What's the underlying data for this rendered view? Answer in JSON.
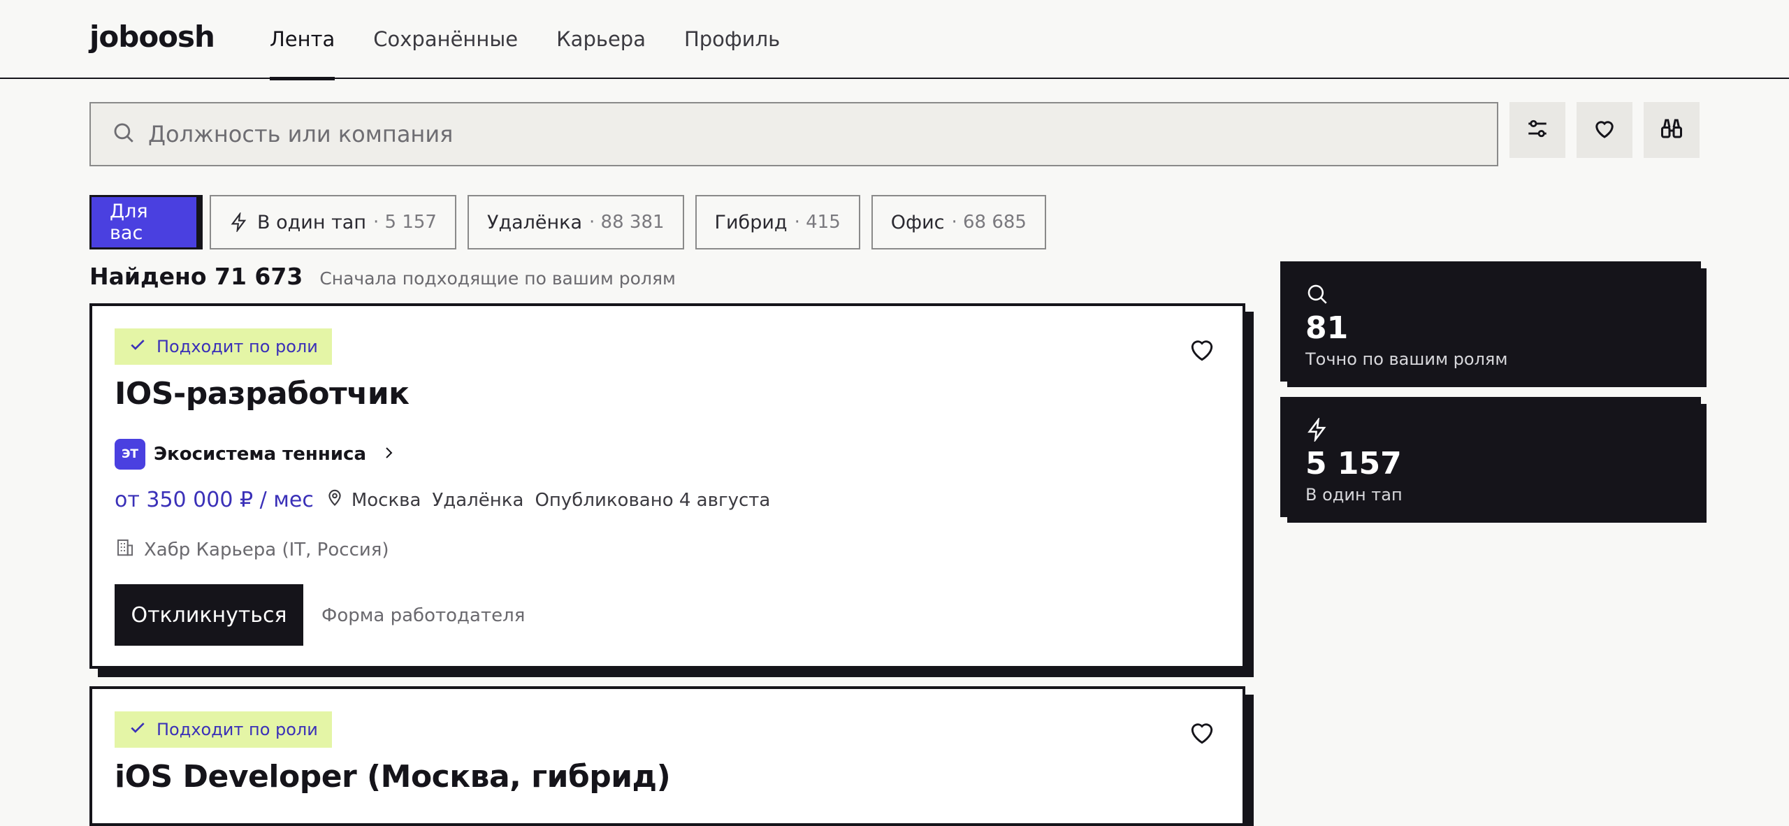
{
  "app": {
    "logo": "joboosh"
  },
  "nav": [
    {
      "label": "Лента",
      "active": true
    },
    {
      "label": "Сохранённые",
      "active": false
    },
    {
      "label": "Карьера",
      "active": false
    },
    {
      "label": "Профиль",
      "active": false
    }
  ],
  "search": {
    "placeholder": "Должность или компания",
    "value": ""
  },
  "toolbar": {
    "icons": [
      "filters-icon",
      "heart-icon",
      "binoculars-icon"
    ]
  },
  "chips": [
    {
      "label": "Для вас",
      "count": "",
      "active": true
    },
    {
      "label": "В один тап",
      "count": "· 5 157",
      "icon": "lightning-icon"
    },
    {
      "label": "Удалёнка",
      "count": "· 88 381"
    },
    {
      "label": "Гибрид",
      "count": "· 415"
    },
    {
      "label": "Офис",
      "count": "· 68 685"
    }
  ],
  "results": {
    "found": "Найдено 71 673",
    "sort": "Сначала подходящие по вашим ролям"
  },
  "cards": [
    {
      "badge": "Подходит по роли",
      "title": "IOS-разработчик",
      "company_logo": "ЭТ",
      "company": "Экосистема тенниса",
      "salary": "от 350 000 ₽ / мес",
      "city": "Москва",
      "format": "Удалёнка",
      "published": "Опубликовано 4 августа",
      "source": "Хабр Карьера (IT, Россия)",
      "apply": "Откликнуться",
      "form": "Форма работодателя"
    },
    {
      "badge": "Подходит по роли",
      "title": "iOS Developer (Москва, гибрид)"
    }
  ],
  "stats": [
    {
      "icon": "search-icon",
      "value": "81",
      "label": "Точно по вашим ролям"
    },
    {
      "icon": "lightning-icon",
      "value": "5 157",
      "label": "В один тап"
    }
  ],
  "colors": {
    "accent": "#4a40e0",
    "dark": "#15141a",
    "badge_bg": "#e4f5a6",
    "salary": "#3a30b8"
  }
}
